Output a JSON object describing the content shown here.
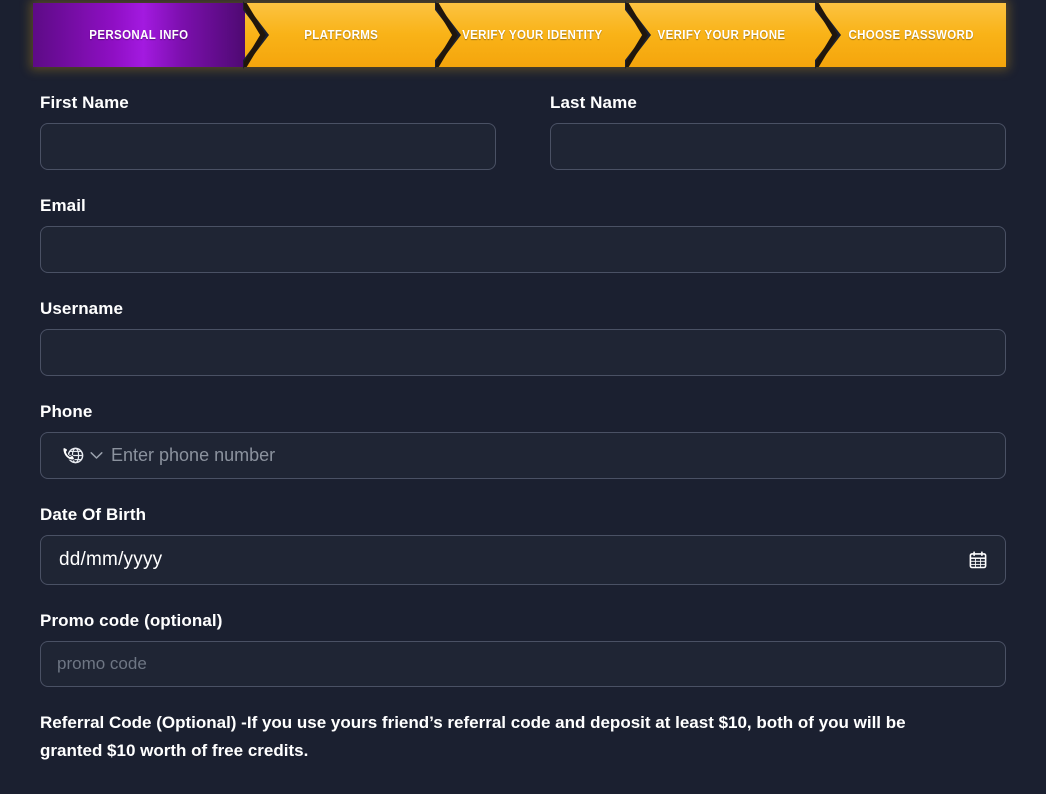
{
  "theme": {
    "page_bg": "#1b2030",
    "input_bg": "#1f2534",
    "input_border": "#4a5164",
    "text": "#ffffff",
    "placeholder": "#6b7280",
    "accent_active": "#a31ae0",
    "accent_pending": "#f9b318",
    "glow": "#fab617"
  },
  "stepper": {
    "steps": [
      {
        "label": "Personal Info",
        "state": "active"
      },
      {
        "label": "Platforms",
        "state": "pending"
      },
      {
        "label": "Verify Your Identity",
        "state": "pending"
      },
      {
        "label": "Verify Your Phone",
        "state": "pending"
      },
      {
        "label": "Choose Password",
        "state": "pending"
      }
    ]
  },
  "form": {
    "first_name": {
      "label": "First Name",
      "value": "",
      "placeholder": ""
    },
    "last_name": {
      "label": "Last Name",
      "value": "",
      "placeholder": ""
    },
    "email": {
      "label": "Email",
      "value": "",
      "placeholder": ""
    },
    "username": {
      "label": "Username",
      "value": "",
      "placeholder": ""
    },
    "phone": {
      "label": "Phone",
      "value": "",
      "placeholder": "Enter phone number",
      "country_icon": "phone-globe-icon",
      "dropdown_icon": "chevron-down-icon"
    },
    "dob": {
      "label": "Date Of Birth",
      "value": "dd/mm/yyyy",
      "picker_icon": "calendar-icon"
    },
    "promo": {
      "label": "Promo code (optional)",
      "value": "",
      "placeholder": "promo code"
    },
    "referral_note": "Referral Code (Optional) -If you use yours friend’s referral code and deposit at least $10, both of you will be granted $10 worth of free credits."
  }
}
